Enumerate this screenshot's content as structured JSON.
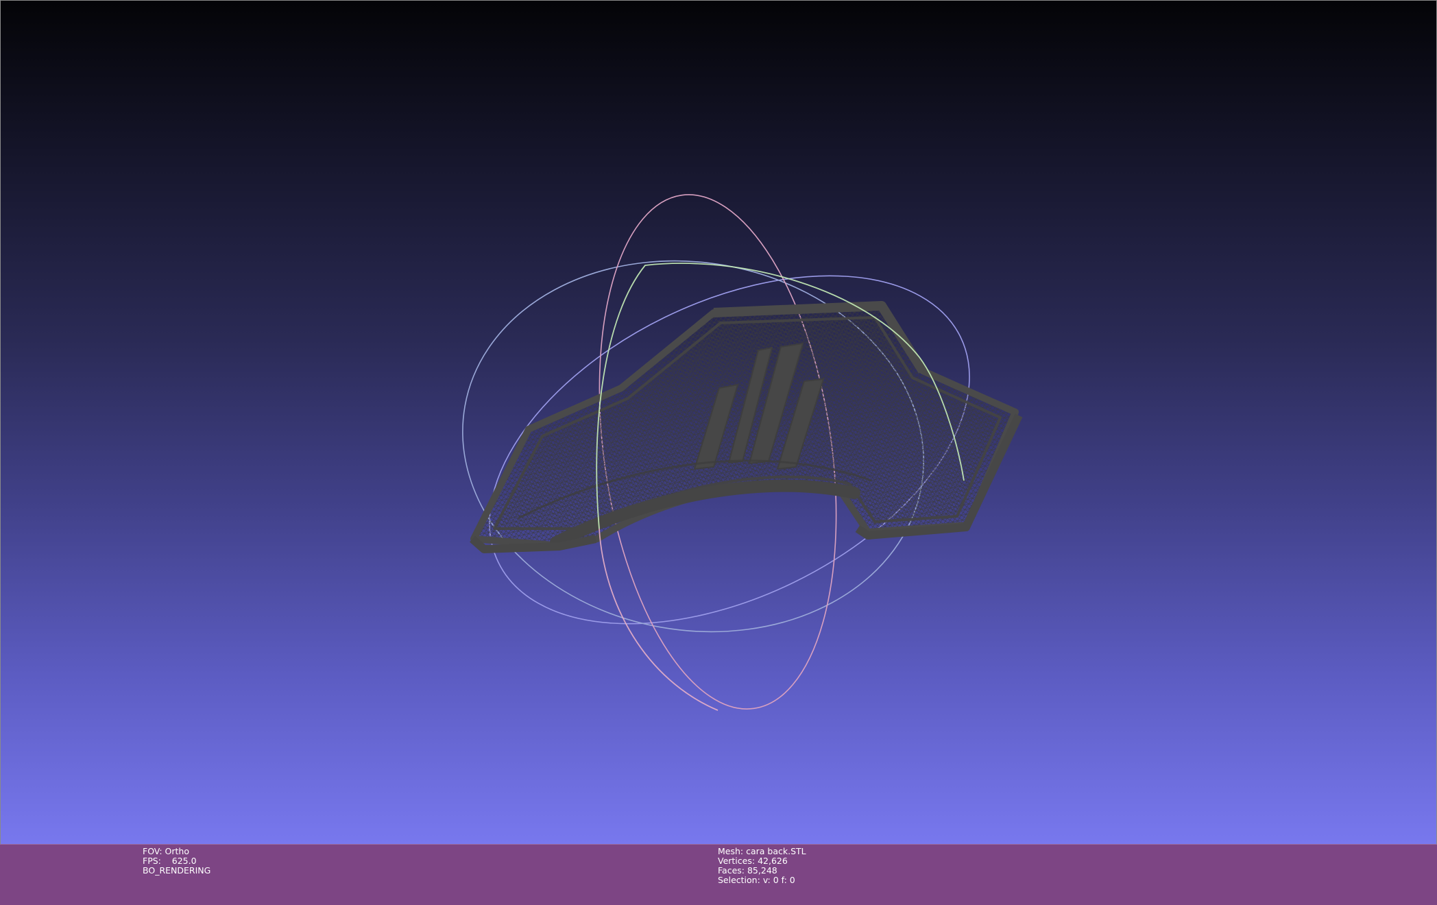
{
  "status": {
    "fov": {
      "label": "FOV:",
      "value": "Ortho"
    },
    "fps": {
      "label": "FPS:",
      "value": "625.0"
    },
    "render_mode": "BO_RENDERING",
    "mesh": {
      "label": "Mesh:",
      "value": "cara back.STL"
    },
    "vertices": {
      "label": "Vertices:",
      "value": "42,626"
    },
    "faces": {
      "label": "Faces:",
      "value": "85,248"
    },
    "selection": {
      "label": "Selection:",
      "value": "v: 0 f: 0"
    }
  },
  "colors": {
    "background_top": "#040407",
    "background_bottom": "#7878ee",
    "status_bar": "#7d4584",
    "mesh_wire": "#474747",
    "trackball_pink": "#e6a6c0",
    "trackball_green": "#b8f0b0",
    "trackball_blue": "#a8a8e0"
  }
}
